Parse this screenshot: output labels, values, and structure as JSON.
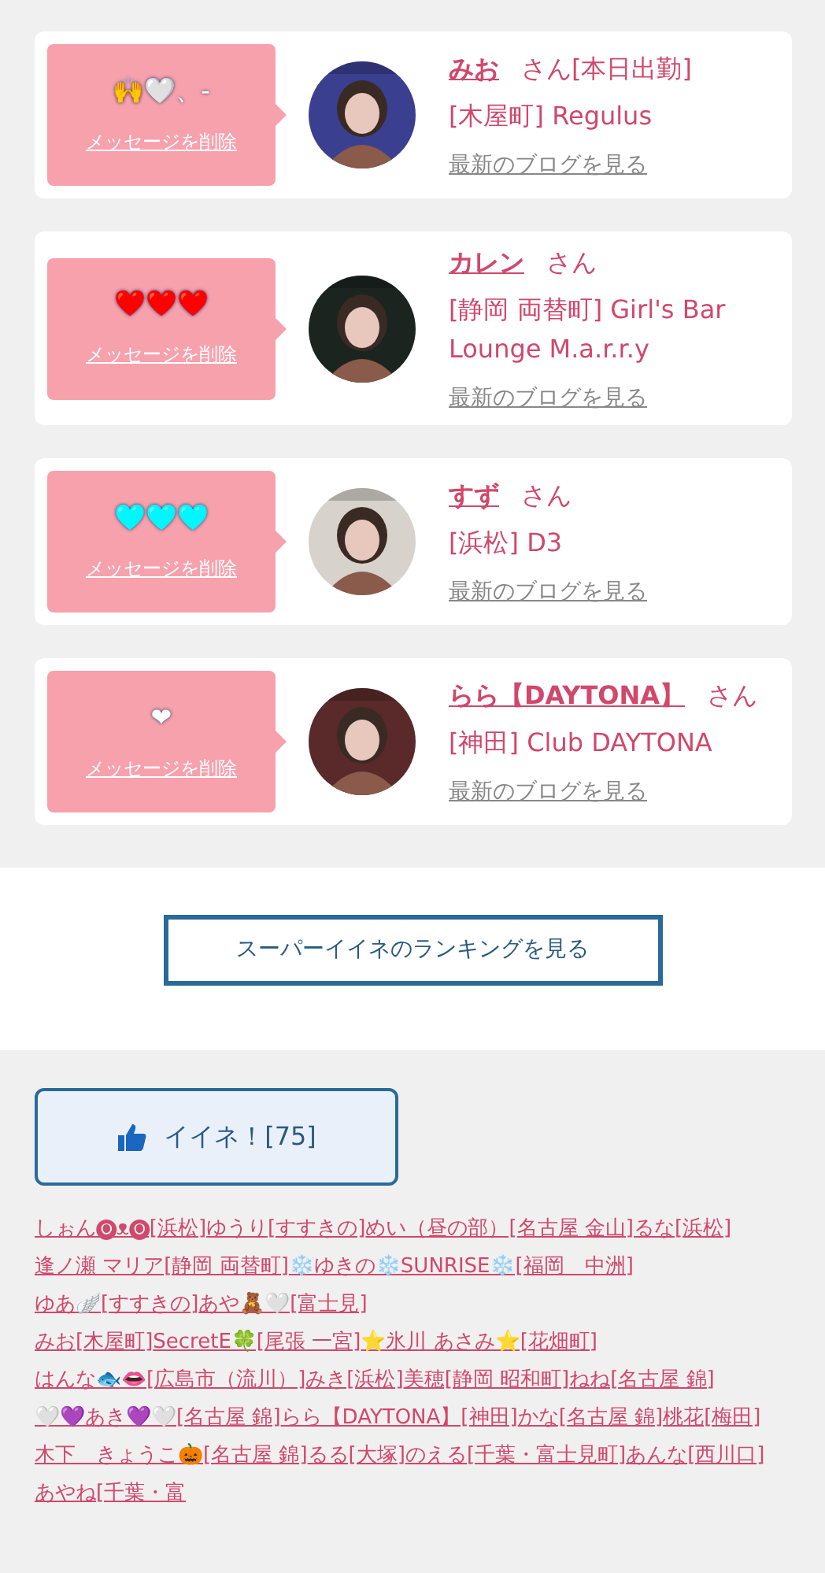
{
  "messages": [
    {
      "message": "🙌🤍、-",
      "delete_link": "メッセージを削除",
      "name": "みお",
      "honorific": "さん[本日出勤]",
      "shop": "[木屋町] Regulus",
      "blog_link": "最新のブログを見る"
    },
    {
      "message": "❤️❤️❤️",
      "delete_link": "メッセージを削除",
      "name": "カレン",
      "honorific": "さん",
      "shop": "[静岡 両替町] Girl's Bar Lounge M.a.r.r.y",
      "blog_link": "最新のブログを見る"
    },
    {
      "message": "🩵🩵🩵",
      "delete_link": "メッセージを削除",
      "name": "すず",
      "honorific": "さん",
      "shop": "[浜松] D3",
      "blog_link": "最新のブログを見る"
    },
    {
      "message": "❤",
      "delete_link": "メッセージを削除",
      "name": "らら【DAYTONA】",
      "honorific": "さん",
      "shop": "[神田] Club DAYTONA",
      "blog_link": "最新のブログを見る"
    }
  ],
  "ranking_button": "スーパーイイネのランキングを見る",
  "like_button": "イイネ！[75]",
  "links": [
    "しぉん🅞ᴥ🅞[浜松]",
    "ゆうり[すすきの]",
    "めい（昼の部）[名古屋 金山]",
    "るな[浜松]",
    "逢ノ瀬 マリア[静岡 両替町]",
    "❄️ゆきの❄️SUNRISE❄️[福岡　中洲]",
    "ゆあ🪽[すすきの]",
    "あや🧸🤍[富士見]",
    "みお[木屋町]",
    "SecretE🍀[尾張 一宮]",
    "⭐️氷川 あさみ⭐️[花畑町]",
    "はんな🐟👄[広島市（流川）]",
    "みき[浜松]",
    "美穂[静岡 昭和町]",
    "ねね[名古屋 錦]",
    "🤍💜あき💜🤍[名古屋 錦]",
    "らら【DAYTONA】[神田]",
    "かな[名古屋 錦]",
    "桃花[梅田]",
    "木下　きょうこ🎃[名古屋 錦]",
    "るる[大塚]",
    "のえる[千葉・富士見町]",
    "あんな[西川口]",
    "あやね[千葉・富"
  ]
}
